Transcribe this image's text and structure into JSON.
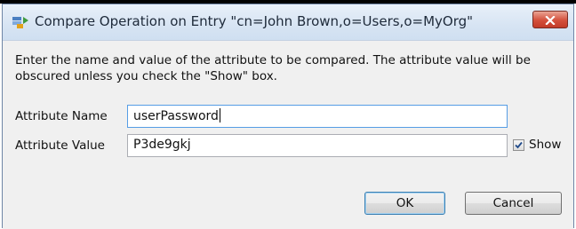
{
  "window": {
    "title": "Compare Operation on Entry \"cn=John Brown,o=Users,o=MyOrg\"",
    "app_icon": "ldap-compare-icon",
    "close_icon": "close-icon"
  },
  "dialog": {
    "instructions": "Enter the name and value of the attribute to be compared.  The attribute value will be obscured unless you check the \"Show\" box.",
    "attribute_name_label": "Attribute Name",
    "attribute_name_value": "userPassword",
    "attribute_value_label": "Attribute Value",
    "attribute_value_value": "P3de9gkj",
    "show_label": "Show",
    "show_checked": true,
    "ok_label": "OK",
    "cancel_label": "Cancel"
  },
  "colors": {
    "titlebar": "#d7e4f3",
    "close_button": "#d4503c",
    "dialog_background": "#f0f0f0",
    "focus_border": "#569de5"
  }
}
